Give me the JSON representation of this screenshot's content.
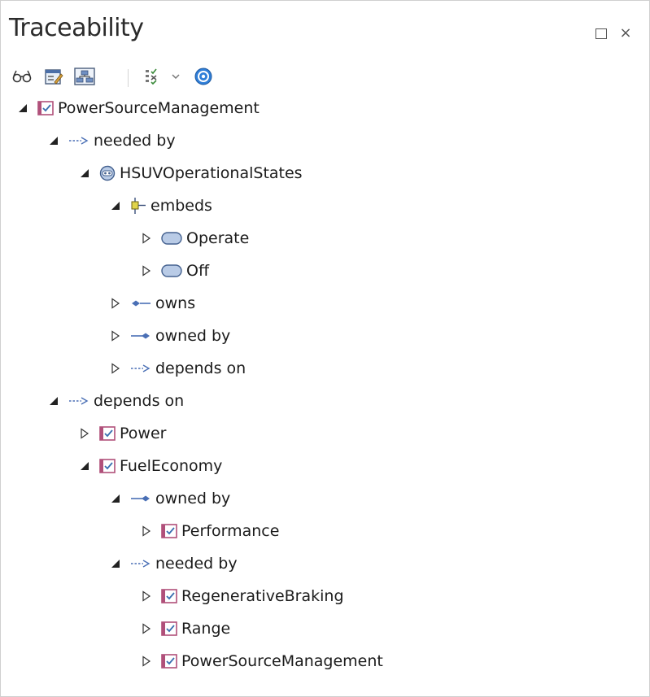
{
  "window": {
    "title": "Traceability",
    "restore_glyph": "□",
    "close_glyph": "×"
  },
  "toolbar": {
    "buttons": [
      "glasses-icon",
      "properties-icon",
      "hierarchy-diagram-icon",
      "filter-checklist-icon",
      "dropdown-arrow-icon",
      "help-icon"
    ]
  },
  "tree": {
    "n0": {
      "label": "PowerSourceManagement",
      "icon": "requirement-icon",
      "expanded": true
    },
    "n1": {
      "label": "needed by",
      "icon": "dependency-arrow-icon",
      "expanded": true
    },
    "n2": {
      "label": "HSUVOperationalStates",
      "icon": "state-machine-icon",
      "expanded": true
    },
    "n3": {
      "label": "embeds",
      "icon": "embed-icon",
      "expanded": true
    },
    "n4": {
      "label": "Operate",
      "icon": "state-icon",
      "expanded": false
    },
    "n5": {
      "label": "Off",
      "icon": "state-icon",
      "expanded": false
    },
    "n6": {
      "label": "owns",
      "icon": "owns-icon",
      "expanded": false
    },
    "n7": {
      "label": "owned by",
      "icon": "owned-by-icon",
      "expanded": false
    },
    "n8": {
      "label": "depends on",
      "icon": "dependency-arrow-icon",
      "expanded": false
    },
    "n9": {
      "label": "depends on",
      "icon": "dependency-arrow-icon",
      "expanded": true
    },
    "n10": {
      "label": "Power",
      "icon": "requirement-icon",
      "expanded": false
    },
    "n11": {
      "label": "FuelEconomy",
      "icon": "requirement-icon",
      "expanded": true
    },
    "n12": {
      "label": "owned by",
      "icon": "owned-by-icon",
      "expanded": true
    },
    "n13": {
      "label": "Performance",
      "icon": "requirement-icon",
      "expanded": false
    },
    "n14": {
      "label": "needed by",
      "icon": "dependency-arrow-icon",
      "expanded": true
    },
    "n15": {
      "label": "RegenerativeBraking",
      "icon": "requirement-icon",
      "expanded": false
    },
    "n16": {
      "label": "Range",
      "icon": "requirement-icon",
      "expanded": false
    },
    "n17": {
      "label": "PowerSourceManagement",
      "icon": "requirement-icon",
      "expanded": false
    }
  },
  "colors": {
    "requirement_border": "#b0507a",
    "requirement_check": "#3a6fb0",
    "link_arrow": "#4a6fb5",
    "state_fill": "#b9cbe6",
    "state_border": "#44618f",
    "help_blue": "#2f7ed8"
  }
}
